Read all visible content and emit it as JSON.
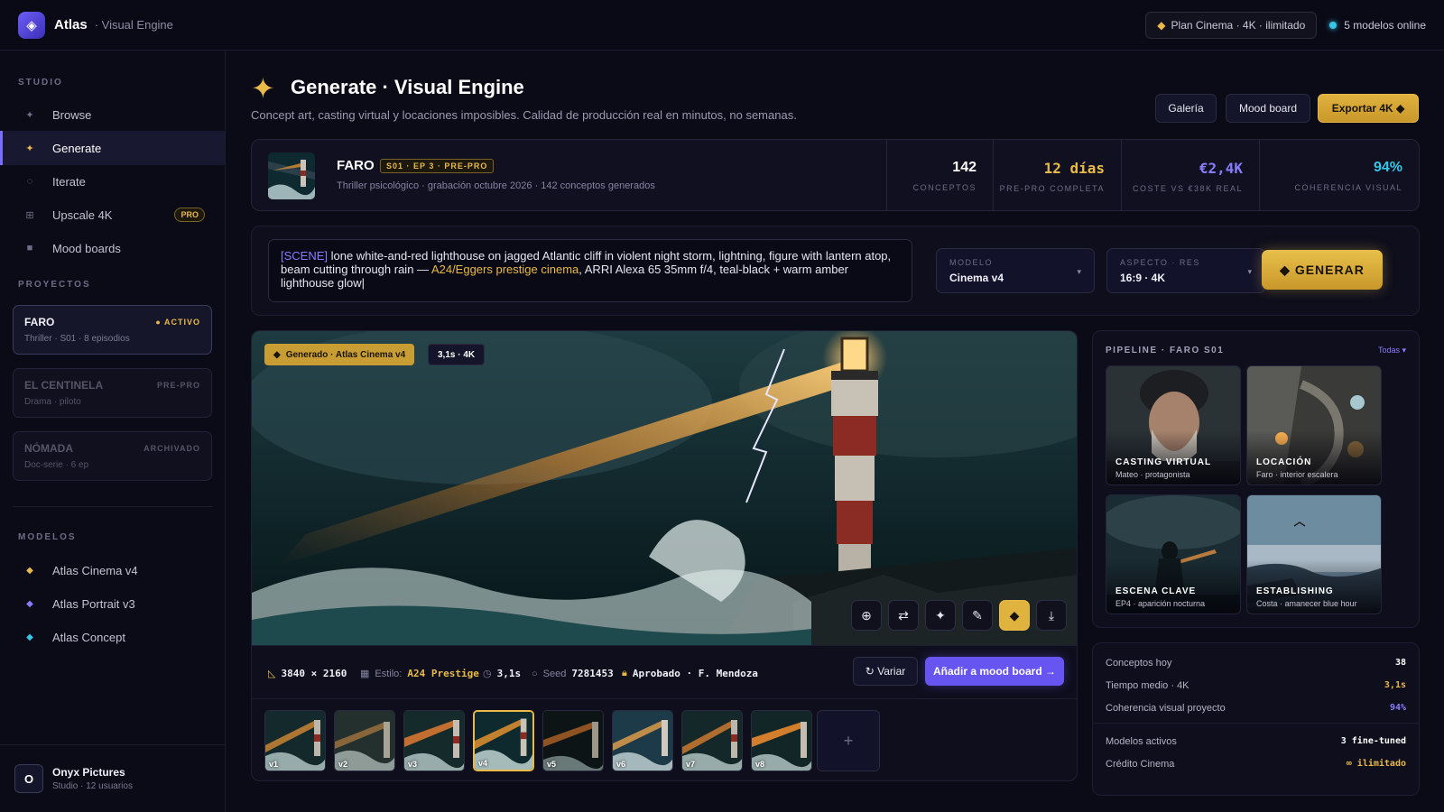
{
  "app": {
    "name": "Atlas",
    "subtitle": "· Visual Engine",
    "logo_glyph": "◈"
  },
  "topbar": {
    "plan": "Plan Cinema · 4K · ilimitado",
    "online": "5 modelos online"
  },
  "sidebar": {
    "studio_label": "STUDIO",
    "nav": [
      {
        "icon": "sparkle-icon",
        "glyph": "✦",
        "label": "Browse"
      },
      {
        "icon": "sparkle-icon",
        "glyph": "✦",
        "label": "Generate"
      },
      {
        "icon": "cycle-icon",
        "glyph": "◌",
        "label": "Iterate"
      },
      {
        "icon": "grid-icon",
        "glyph": "⊞",
        "label": "Upscale 4K",
        "badge": "PRO"
      },
      {
        "icon": "board-icon",
        "glyph": "■",
        "label": "Mood boards"
      }
    ],
    "projects_label": "PROYECTOS",
    "projects": [
      {
        "name": "FARO",
        "status": "● ACTIVO",
        "meta": "Thriller · S01 · 8 episodios"
      },
      {
        "name": "EL CENTINELA",
        "status": "PRE-PRO",
        "meta": "Drama · piloto"
      },
      {
        "name": "NÓMADA",
        "status": "ARCHIVADO",
        "meta": "Doc-serie · 6 ep"
      }
    ],
    "models_label": "MODELOS",
    "models": [
      {
        "label": "Atlas Cinema v4",
        "glyph": "◆",
        "color": "#e9b949"
      },
      {
        "label": "Atlas Portrait v3",
        "glyph": "◆",
        "color": "#8a7cff"
      },
      {
        "label": "Atlas Concept",
        "glyph": "◆",
        "color": "#35c6e8"
      }
    ],
    "org": {
      "initial": "O",
      "name": "Onyx Pictures",
      "sub": "Studio · 12 usuarios"
    }
  },
  "header": {
    "title": "Generate · Visual Engine",
    "subtitle": "Concept art, casting virtual y locaciones imposibles. Calidad de producción real en minutos, no semanas.",
    "buttons": {
      "gallery": "Galería",
      "mood": "Mood board",
      "export": "Exportar 4K ◆"
    }
  },
  "project_bar": {
    "name": "FARO",
    "episode": "S01 · EP 3 · PRE-PRO",
    "meta": "Thriller psicológico · grabación octubre 2026 · 142 conceptos generados",
    "stats": [
      {
        "value": "142",
        "label": "CONCEPTOS",
        "color": "#ffffff"
      },
      {
        "value": "12 días",
        "label": "PRE-PRO COMPLETA",
        "color": "#e9b949"
      },
      {
        "value": "€2,4K",
        "label": "COSTE VS €38K REAL",
        "color": "#8a7cff"
      },
      {
        "value": "94%",
        "label": "COHERENCIA VISUAL",
        "color": "#35c6e8"
      }
    ]
  },
  "prompt": {
    "tag": "[SCENE]",
    "text1": " lone white-and-red lighthouse on jagged Atlantic cliff in violent night storm, lightning, figure with lantern atop, beam cutting through rain — ",
    "highlight": "A24/Eggers prestige cinema",
    "text2": ", ARRI Alexa 65 35mm f/4, teal-black + warm amber lighthouse glow|",
    "model_label": "MODELO",
    "model_value": "Cinema v4",
    "aspect_label": "ASPECTO · RES",
    "aspect_value": "16:9 · 4K",
    "generate": "◆ GENERAR"
  },
  "viewer": {
    "badge": "Generado · Atlas Cinema v4",
    "res_badge": "3,1s · 4K",
    "tools": [
      "target-icon",
      "swap-icon",
      "sparkle-icon",
      "brush-icon",
      "diamond-icon",
      "download-icon"
    ],
    "tool_glyphs": [
      "⊕",
      "⇄",
      "✦",
      "✎",
      "◆",
      "⤓"
    ],
    "resolution": "3840 × 2160",
    "style_label": "Estilo:",
    "style_value": "A24 Prestige",
    "time": "3,1s",
    "seed_label": "Seed",
    "seed_value": "7281453",
    "approved": "Aprobado · F. Mendoza",
    "vary": "↻ Variar",
    "add_mood": "Añadir a mood board →",
    "variants": [
      "v1",
      "v2",
      "v3",
      "v4",
      "v5",
      "v6",
      "v7",
      "v8"
    ],
    "selected_variant": "v4",
    "add": "+"
  },
  "pipeline": {
    "title": "PIPELINE · FARO S01",
    "filter": "Todas ▾",
    "cards": [
      {
        "title": "CASTING VIRTUAL",
        "sub": "Mateo · protagonista"
      },
      {
        "title": "LOCACIÓN",
        "sub": "Faro · interior escalera"
      },
      {
        "title": "ESCENA CLAVE",
        "sub": "EP4 · aparición nocturna"
      },
      {
        "title": "ESTABLISHING",
        "sub": "Costa · amanecer blue hour"
      }
    ]
  },
  "metrics": [
    {
      "label": "Conceptos hoy",
      "value": "38",
      "color": "#ffffff"
    },
    {
      "label": "Tiempo medio · 4K",
      "value": "3,1s",
      "color": "#e9b949"
    },
    {
      "label": "Coherencia visual proyecto",
      "value": "94%",
      "color": "#8a7cff"
    },
    {
      "label": "Modelos activos",
      "value": "3 fine-tuned",
      "color": "#ffffff"
    },
    {
      "label": "Crédito Cinema",
      "value": "∞ ilimitado",
      "color": "#e9b949"
    }
  ]
}
